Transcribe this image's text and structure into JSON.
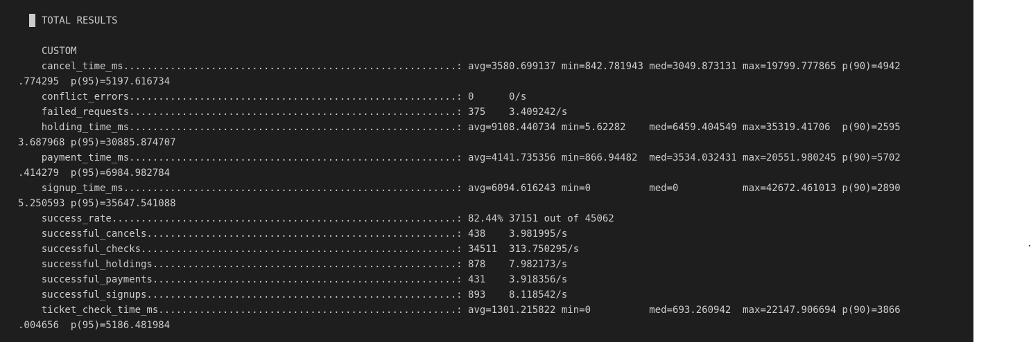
{
  "terminal": {
    "section_title": "TOTAL RESULTS",
    "group_title": "CUSTOM",
    "lines": [
      "    cancel_time_ms.........................................................: avg=3580.699137 min=842.781943 med=3049.873131 max=19799.777865 p(90)=4942",
      ".774295  p(95)=5197.616734",
      "    conflict_errors........................................................: 0      0/s",
      "    failed_requests........................................................: 375    3.409242/s",
      "    holding_time_ms........................................................: avg=9108.440734 min=5.62282    med=6459.404549 max=35319.41706  p(90)=2595",
      "3.687968 p(95)=30885.874707",
      "    payment_time_ms........................................................: avg=4141.735356 min=866.94482  med=3534.032431 max=20551.980245 p(90)=5702",
      ".414279  p(95)=6984.982784",
      "    signup_time_ms.........................................................: avg=6094.616243 min=0          med=0           max=42672.461013 p(90)=2890",
      "5.250593 p(95)=35647.541088",
      "    success_rate...........................................................: 82.44% 37151 out of 45062",
      "    successful_cancels.....................................................: 438    3.981995/s",
      "    successful_checks......................................................: 34511  313.750295/s",
      "    successful_holdings....................................................: 878    7.982173/s",
      "    successful_payments....................................................: 431    3.918356/s",
      "    successful_signups.....................................................: 893    8.118542/s",
      "    ticket_check_time_ms...................................................: avg=1301.215822 min=0          med=693.260942  max=22147.906694 p(90)=3866",
      ".004656  p(95)=5186.481984"
    ]
  }
}
